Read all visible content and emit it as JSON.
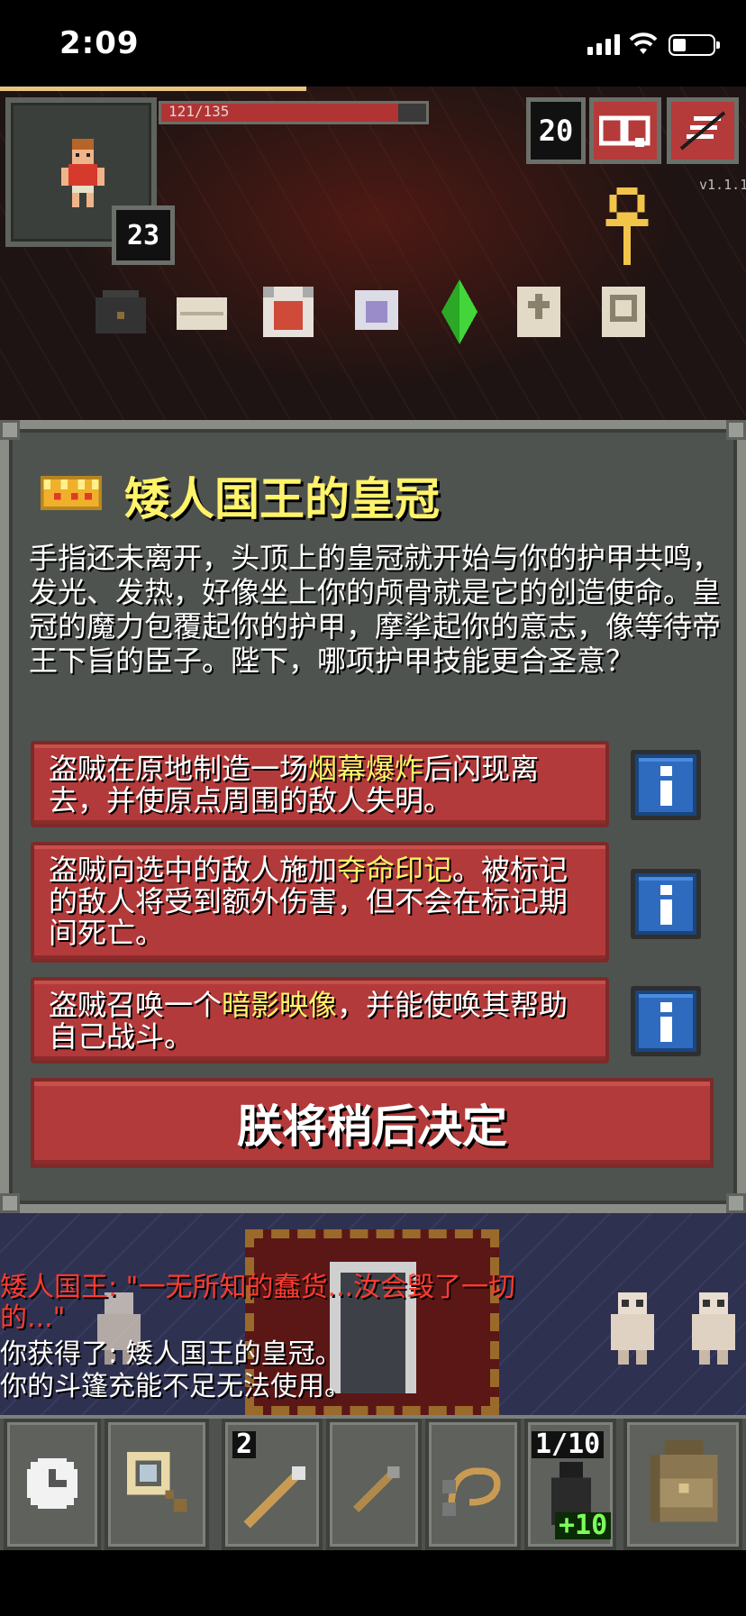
{
  "status_bar": {
    "time": "2:09"
  },
  "hud": {
    "hp_text": "121/135",
    "hp_fraction": 0.896,
    "level": "23",
    "depth": "20",
    "version": "v1.1.1"
  },
  "dialog": {
    "title": "矮人国王的皇冠",
    "description": "手指还未离开，头顶上的皇冠就开始与你的护甲共鸣，发光、发热，好像坐上你的颅骨就是它的创造使命。皇冠的魔力包覆起你的护甲，摩挲起你的意志，像等待帝王下旨的臣子。陛下，哪项护甲技能更合圣意？",
    "choices": [
      {
        "before": "盗贼在原地制造一场",
        "highlight": "烟幕爆炸",
        "after": "后闪现离去，并使原点周围的敌人失明。"
      },
      {
        "before": "盗贼向选中的敌人施加",
        "highlight": "夺命印记",
        "after": "。被标记的敌人将受到额外伤害，但不会在标记期间死亡。"
      },
      {
        "before": "盗贼召唤一个",
        "highlight": "暗影映像",
        "after": "，并能使唤其帮助自己战斗。"
      }
    ],
    "decide_label": "朕将稍后决定"
  },
  "log": [
    {
      "text": "矮人国王: \"一无所知的蠢货...汝会毁了一切",
      "color": "#ff3b30"
    },
    {
      "text": "的...\"",
      "color": "#ff3b30"
    },
    {
      "text": "你获得了: 矮人国王的皇冠。",
      "color": "#ffffff"
    },
    {
      "text": "你的斗篷充能不足无法使用。",
      "color": "#ffffff"
    }
  ],
  "toolbar": {
    "quickslot_1_qty": "2",
    "quickslot_4_qty": "1/10",
    "quickslot_4_bonus": "+10"
  },
  "colors": {
    "accent_yellow": "#fff36a",
    "button_red": "#b33a3a",
    "info_blue": "#2e6bbf",
    "log_red": "#ff3b30"
  },
  "icons": [
    "signal-icon",
    "wifi-icon",
    "battery-icon",
    "journal-icon",
    "menu-icon",
    "ankh-icon",
    "crown-icon",
    "info-icon",
    "clock-icon",
    "search-icon",
    "backpack-icon"
  ]
}
